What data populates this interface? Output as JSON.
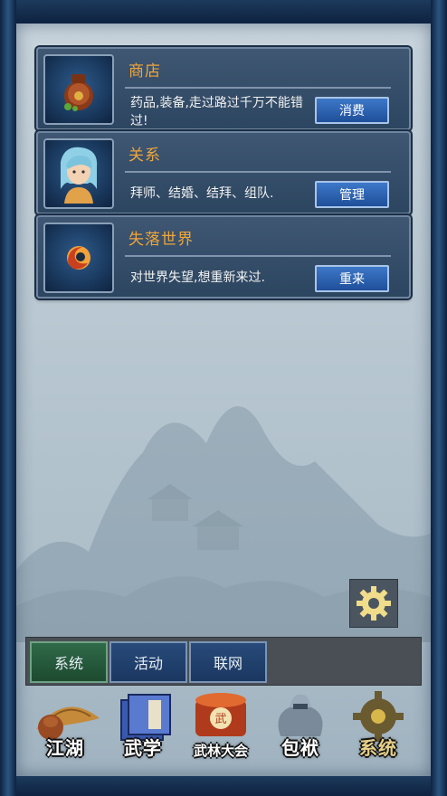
{
  "cards": [
    {
      "title": "商店",
      "desc": "药品,装备,走过路过千万不能错过!",
      "button": "消费",
      "icon": "money-bag-icon"
    },
    {
      "title": "关系",
      "desc": "拜师、结婚、结拜、组队.",
      "button": "管理",
      "icon": "character-portrait-icon"
    },
    {
      "title": "失落世界",
      "desc": "对世界失望,想重新来过.",
      "button": "重来",
      "icon": "fire-swirl-icon"
    }
  ],
  "tabs": [
    {
      "label": "系统",
      "active": true
    },
    {
      "label": "活动",
      "active": false
    },
    {
      "label": "联网",
      "active": false
    }
  ],
  "nav": [
    {
      "label": "江湖",
      "icon": "bamboo-hat-icon"
    },
    {
      "label": "武学",
      "icon": "martial-book-icon"
    },
    {
      "label": "武林大会",
      "icon": "war-drum-icon"
    },
    {
      "label": "包袱",
      "icon": "bundle-bag-icon"
    },
    {
      "label": "系统",
      "icon": "system-gear-icon",
      "active": true
    }
  ],
  "colors": {
    "title_gold": "#f1a53a",
    "button_blue": "#2a63b5",
    "tab_active_green": "#2f6a48"
  }
}
